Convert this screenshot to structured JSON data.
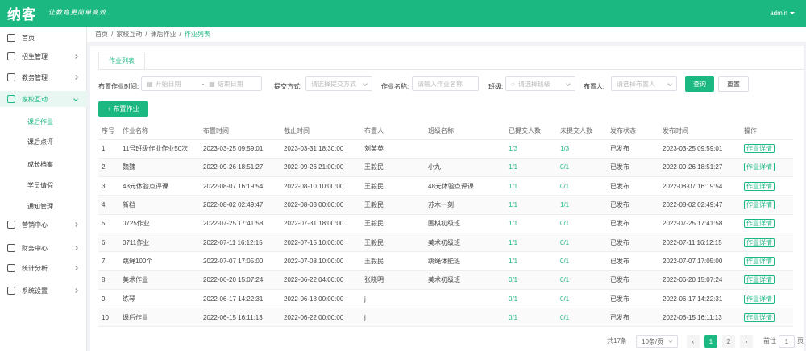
{
  "header": {
    "logo": "纳客",
    "slogan": "让教育更简单高效",
    "user": "admin"
  },
  "sidebar": {
    "items": [
      {
        "label": "首页",
        "icon": "home-icon",
        "has_arrow": false
      },
      {
        "label": "招生管理",
        "icon": "user-icon",
        "has_arrow": true
      },
      {
        "label": "教务管理",
        "icon": "grid-icon",
        "has_arrow": true
      },
      {
        "label": "家校互动",
        "icon": "chat-icon",
        "has_arrow": true,
        "active": true
      },
      {
        "label": "营销中心",
        "icon": "gift-icon",
        "has_arrow": true
      },
      {
        "label": "财务中心",
        "icon": "wallet-icon",
        "has_arrow": true
      },
      {
        "label": "统计分析",
        "icon": "chart-icon",
        "has_arrow": true
      },
      {
        "label": "系统设置",
        "icon": "gear-icon",
        "has_arrow": true
      }
    ],
    "subitems": [
      "课后作业",
      "课后点评",
      "成长档案",
      "学员请假",
      "通知管理"
    ]
  },
  "breadcrumb": [
    "首页",
    "家校互动",
    "课后作业",
    "作业列表"
  ],
  "tab": "作业列表",
  "filters": {
    "publish_time_label": "布置作业时间:",
    "start_placeholder": "开始日期",
    "range_sep": "-",
    "end_placeholder": "结束日期",
    "submit_mode_label": "提交方式:",
    "submit_mode_placeholder": "请选择提交方式",
    "name_label": "作业名称:",
    "name_placeholder": "请输入作业名称",
    "class_label": "班级:",
    "class_placeholder": "请选择班级",
    "owner_label": "布置人:",
    "owner_placeholder": "请选择布置人",
    "search_btn": "查询",
    "reset_btn": "重置"
  },
  "add_button": "+ 布置作业",
  "table": {
    "columns": [
      "序号",
      "作业名称",
      "布置时间",
      "截止时间",
      "布置人",
      "班级名称",
      "已提交人数",
      "未提交人数",
      "发布状态",
      "发布时间",
      "操作"
    ],
    "rows": [
      [
        "1",
        "11号班级作业作业50次",
        "2023-03-25 09:59:01",
        "2023-03-31 18:30:00",
        "刘英英",
        "",
        "1/3",
        "1/3",
        "已发布",
        "2023-03-25 09:59:01",
        "作业详情"
      ],
      [
        "2",
        "魏魏",
        "2022-09-26 18:51:27",
        "2022-09-26 21:00:00",
        "王毅民",
        "小九",
        "1/1",
        "0/1",
        "已发布",
        "2022-09-26 18:51:27",
        "作业详情"
      ],
      [
        "3",
        "48元体验点评课",
        "2022-08-07 16:19:54",
        "2022-08-10 10:00:00",
        "王毅民",
        "48元体验点评课",
        "1/1",
        "0/1",
        "已发布",
        "2022-08-07 16:19:54",
        "作业详情"
      ],
      [
        "4",
        "新档",
        "2022-08-02 02:49:47",
        "2022-08-03 00:00:00",
        "王毅民",
        "苏木一刻",
        "1/1",
        "1/1",
        "已发布",
        "2022-08-02 02:49:47",
        "作业详情"
      ],
      [
        "5",
        "0725作业",
        "2022-07-25 17:41:58",
        "2022-07-31 18:00:00",
        "王毅民",
        "围棋初级班",
        "1/1",
        "0/1",
        "已发布",
        "2022-07-25 17:41:58",
        "作业详情"
      ],
      [
        "6",
        "0711作业",
        "2022-07-11 16:12:15",
        "2022-07-15 10:00:00",
        "王毅民",
        "美术初级班",
        "1/1",
        "0/1",
        "已发布",
        "2022-07-11 16:12:15",
        "作业详情"
      ],
      [
        "7",
        "跳绳100个",
        "2022-07-07 17:05:00",
        "2022-07-08 10:00:00",
        "王毅民",
        "跳绳体能班",
        "1/1",
        "0/1",
        "已发布",
        "2022-07-07 17:05:00",
        "作业详情"
      ],
      [
        "8",
        "美术作业",
        "2022-06-20 15:07:24",
        "2022-06-22 04:00:00",
        "张晓明",
        "美术初级班",
        "0/1",
        "0/1",
        "已发布",
        "2022-06-20 15:07:24",
        "作业详情"
      ],
      [
        "9",
        "练琴",
        "2022-06-17 14:22:31",
        "2022-06-18 00:00:00",
        "j",
        "",
        "0/1",
        "0/1",
        "已发布",
        "2022-06-17 14:22:31",
        "作业详情"
      ],
      [
        "10",
        "课后作业",
        "2022-06-15 16:11:13",
        "2022-06-22 00:00:00",
        "j",
        "",
        "0/1",
        "0/1",
        "已发布",
        "2022-06-15 16:11:13",
        "作业详情"
      ]
    ]
  },
  "pagination": {
    "total": "共17条",
    "page_size": "10条/页",
    "pages": [
      "1",
      "2"
    ],
    "current": "1",
    "goto_label": "前往",
    "goto_value": "1",
    "goto_unit": "页"
  },
  "colors": {
    "primary": "#1bb881"
  }
}
